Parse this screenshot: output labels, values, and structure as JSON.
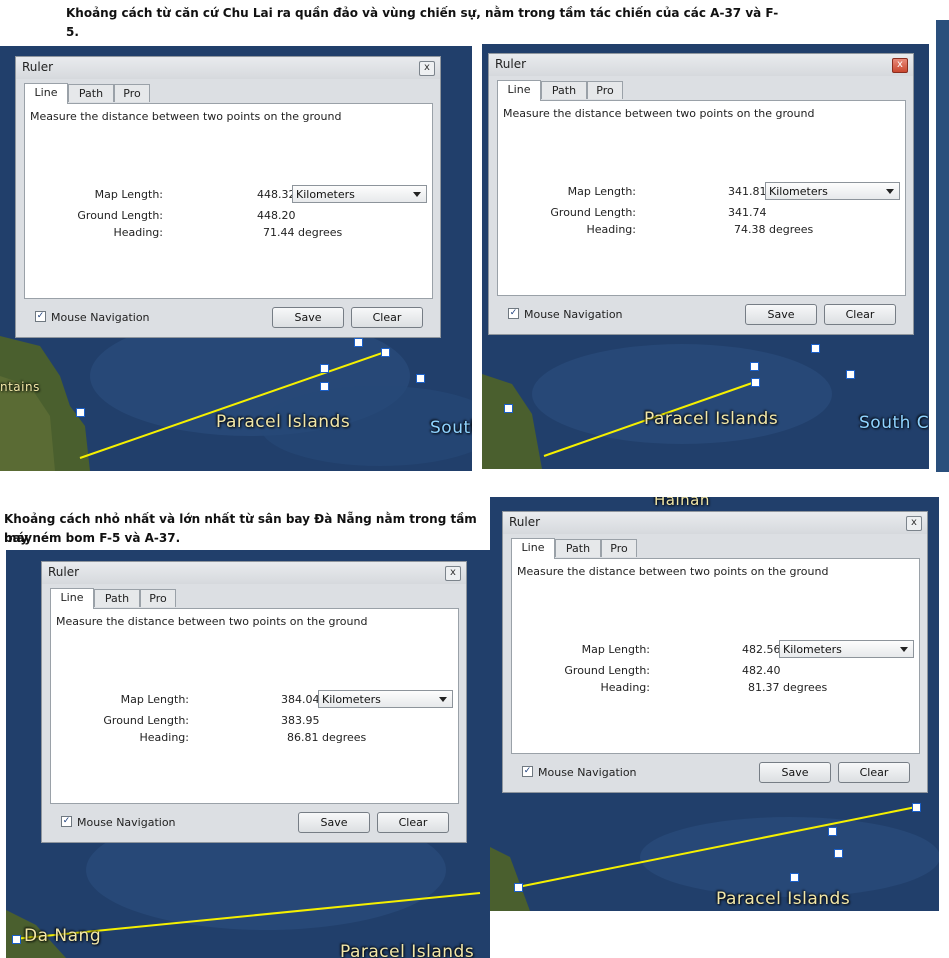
{
  "captions": {
    "top": "Khoảng cách từ căn cứ Chu Lai ra quần đảo và vùng chiến sự, nằm trong tầm tác chiến của các A-37 và F-5.",
    "bottom_line1": "Khoảng cách nhỏ nhất và lớn nhất từ sân bay Đà Nẵng nằm trong tầm máy",
    "bottom_line2": "bay ném bom F-5 và A-37."
  },
  "map_labels": {
    "paracel": "Paracel Islands",
    "south": "South",
    "south_c": "South C",
    "mountains": "ntains",
    "hainan": "Hainan",
    "da_nang": "Da Nang"
  },
  "ruler_common": {
    "title": "Ruler",
    "close_glyph": "x",
    "tabs": [
      "Line",
      "Path",
      "Pro"
    ],
    "description": "Measure the distance between two points on the ground",
    "map_length_label": "Map Length:",
    "ground_length_label": "Ground Length:",
    "heading_label": "Heading:",
    "unit": "Kilometers",
    "check_glyph": "✓",
    "mouse_navigation": "Mouse Navigation",
    "save": "Save",
    "clear": "Clear"
  },
  "rulers": [
    {
      "map_length": "448.32",
      "ground_length": "448.20",
      "heading": "71.44 degrees"
    },
    {
      "map_length": "341.81",
      "ground_length": "341.74",
      "heading": "74.38 degrees"
    },
    {
      "map_length": "384.04",
      "ground_length": "383.95",
      "heading": "86.81 degrees"
    },
    {
      "map_length": "482.56",
      "ground_length": "482.40",
      "heading": "81.37 degrees"
    }
  ],
  "colors": {
    "sea": "#1d3a66",
    "land": "#3f5a2a",
    "measure_line": "#f5f000",
    "label": "#f2e7a8"
  }
}
